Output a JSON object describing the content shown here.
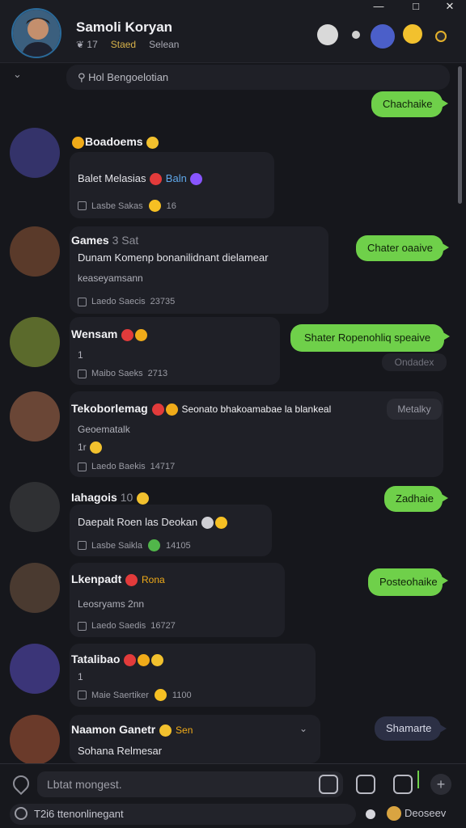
{
  "header": {
    "name": "Samoli Koryan",
    "meta": [
      "❦ 17",
      "Staed",
      "Selean"
    ]
  },
  "window": {
    "minimize": "—",
    "maximize": "□",
    "close": "✕"
  },
  "search": {
    "text": "Hol Bengoelotian"
  },
  "messages": [
    {
      "name": "Boadoems",
      "text": "Balet Melasias",
      "text_tag": "Baln",
      "meta": "Lasbe Sakas",
      "meta_value": "16"
    },
    {
      "name": "Games",
      "name_extra": "3 Sat",
      "text": "Dunam Komenp bonanilidnant dielamear",
      "sub": "keaseyamsann",
      "meta": "Laedo Saecis",
      "meta_value": "23735"
    },
    {
      "name": "Wensam",
      "sub": "1",
      "meta": "Maibo Saeks",
      "meta_value": "2713"
    },
    {
      "name": "Tekoborlemag",
      "name_extra": "Seonato bhakoamabae la blankeal",
      "sub": "Geoematalk",
      "sub2": "1r",
      "meta": "Laedo Baekis",
      "meta_value": "14717"
    },
    {
      "name": "Iahagois",
      "name_extra": "10",
      "text": "Daepalt Roen las Deokan",
      "meta": "Lasbe Saikla",
      "meta_value": "14105"
    },
    {
      "name": "Lkenpadt",
      "name_extra": "Rona",
      "sub": "Leosryams 2nn",
      "meta": "Laedo Saedis",
      "meta_value": "16727"
    },
    {
      "name": "Tatalibao",
      "sub": "1",
      "meta": "Maie Saertiker",
      "meta_value": "1100"
    },
    {
      "name": "Naamon Ganetr",
      "name_extra": "Sen",
      "text": "Sohana Relmesar"
    }
  ],
  "bubbles": [
    "Chachaike",
    "Chater oaaive",
    "Shater Ropenohliq speaive",
    "Ondadex",
    "Metalky",
    "Zadhaie",
    "Posteohaike",
    "Shamarte"
  ],
  "composer": {
    "placeholder": "Lbtat mongest.",
    "status": "T2i6 ttenonlinegant",
    "status_right": "Deoseev"
  }
}
